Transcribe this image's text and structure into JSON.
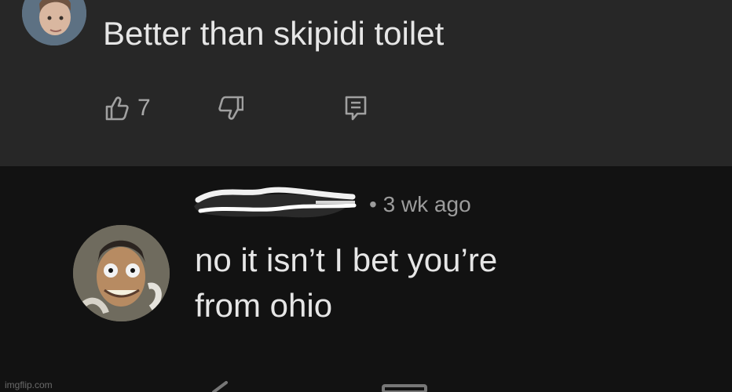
{
  "comments": [
    {
      "text": "Better than skipidi toilet",
      "likes": "7",
      "actions": {
        "like_icon": "thumbs-up-icon",
        "dislike_icon": "thumbs-down-icon",
        "reply_icon": "reply-icon"
      }
    },
    {
      "meta": "• 3 wk ago",
      "text_line1": "no it isn’t I bet you’re",
      "text_line2": "from ohio"
    }
  ],
  "watermark": "imgflip.com",
  "colors": {
    "top_panel_bg": "#272727",
    "bottom_panel_bg": "#121212",
    "text": "#e6e6e6",
    "muted_text": "#9c9c9c"
  }
}
